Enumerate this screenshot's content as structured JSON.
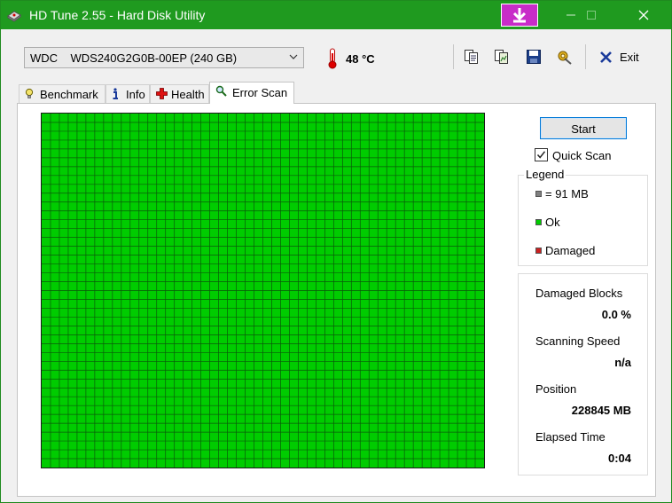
{
  "window": {
    "title": "HD Tune 2.55 - Hard Disk Utility"
  },
  "toolbar": {
    "drive_vendor": "WDC",
    "drive_model": "WDS240G2G0B-00EP (240 GB)",
    "temperature": "48 °C",
    "exit_label": "Exit"
  },
  "tabs": [
    {
      "label": "Benchmark",
      "icon": "lightbulb-icon"
    },
    {
      "label": "Info",
      "icon": "info-icon"
    },
    {
      "label": "Health",
      "icon": "health-cross-icon"
    },
    {
      "label": "Error Scan",
      "icon": "magnifier-icon",
      "active": true
    }
  ],
  "scan": {
    "start_label": "Start",
    "quick_scan_label": "Quick Scan",
    "quick_scan_checked": true,
    "grid_cols": 50,
    "grid_rows": 40,
    "ok_color": "#00cc00"
  },
  "legend": {
    "title": "Legend",
    "items": [
      {
        "label": "= 91 MB",
        "color": "#808080"
      },
      {
        "label": "Ok",
        "color": "#00cc00"
      },
      {
        "label": "Damaged",
        "color": "#cc2020"
      }
    ]
  },
  "stats": {
    "damaged_blocks_label": "Damaged Blocks",
    "damaged_blocks_value": "0.0 %",
    "scanning_speed_label": "Scanning Speed",
    "scanning_speed_value": "n/a",
    "position_label": "Position",
    "position_value": "228845 MB",
    "elapsed_time_label": "Elapsed Time",
    "elapsed_time_value": "0:04"
  }
}
